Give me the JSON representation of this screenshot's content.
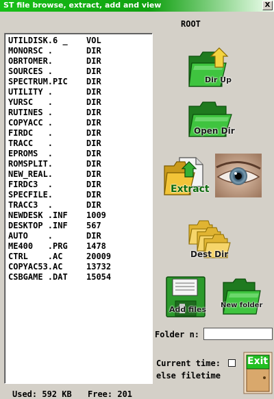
{
  "window": {
    "title": "ST file browse, extract, add and view",
    "close_label": "X"
  },
  "path": {
    "current": "ROOT"
  },
  "files": [
    {
      "name": "UTILDISK.6 _",
      "size": "VOL"
    },
    {
      "name": "MONORSC .",
      "size": "DIR"
    },
    {
      "name": "OBRTOMER.",
      "size": "DIR"
    },
    {
      "name": "SOURCES .",
      "size": "DIR"
    },
    {
      "name": "SPECTRUM.PIC",
      "size": "DIR"
    },
    {
      "name": "UTILITY .",
      "size": "DIR"
    },
    {
      "name": "YURSC   .",
      "size": "DIR"
    },
    {
      "name": "RUTINES .",
      "size": "DIR"
    },
    {
      "name": "COPYACC .",
      "size": "DIR"
    },
    {
      "name": "FIRDC   .",
      "size": "DIR"
    },
    {
      "name": "TRACC   .",
      "size": "DIR"
    },
    {
      "name": "EPROMS  .",
      "size": "DIR"
    },
    {
      "name": "ROMSPLIT.",
      "size": "DIR"
    },
    {
      "name": "NEW_REAL.",
      "size": "DIR"
    },
    {
      "name": "FIRDC3  .",
      "size": "DIR"
    },
    {
      "name": "SPECFILE.",
      "size": "DIR"
    },
    {
      "name": "TRACC3  .",
      "size": "DIR"
    },
    {
      "name": "NEWDESK .INF",
      "size": "1009"
    },
    {
      "name": "DESKTOP .INF",
      "size": "567"
    },
    {
      "name": "AUTO    .",
      "size": "DIR"
    },
    {
      "name": "ME400   .PRG",
      "size": "1478"
    },
    {
      "name": "CTRL    .AC",
      "size": "20009"
    },
    {
      "name": "COPYAC53.AC",
      "size": "13732"
    },
    {
      "name": "CSBGAME .DAT",
      "size": "15054"
    }
  ],
  "buttons": {
    "dir_up": "Dir Up",
    "open_dir": "Open Dir",
    "extract": "Extract",
    "dest_dir": "Dest Dir",
    "add_files": "Add files",
    "new_folder": "New folder",
    "exit": "Exit"
  },
  "folder": {
    "label": "Folder n:",
    "value": ""
  },
  "time_options": {
    "current_time": "Current time:",
    "else_filetime": "else filetime"
  },
  "status": {
    "used": "Used: 592 KB",
    "free": "Free: 201"
  },
  "colors": {
    "title_green": "#18c018",
    "folder_green": "#2aa02a",
    "folder_yellow": "#f2c438",
    "exit_green": "#22c022"
  },
  "icons": {
    "dir_up": "folder-up-arrow-icon",
    "open_dir": "open-folder-icon",
    "extract": "extract-icon",
    "view": "eye-icon",
    "dest_dir": "dest-folders-icon",
    "add_files": "floppy-disk-icon",
    "new_folder": "new-folder-icon",
    "exit": "exit-door-icon"
  }
}
